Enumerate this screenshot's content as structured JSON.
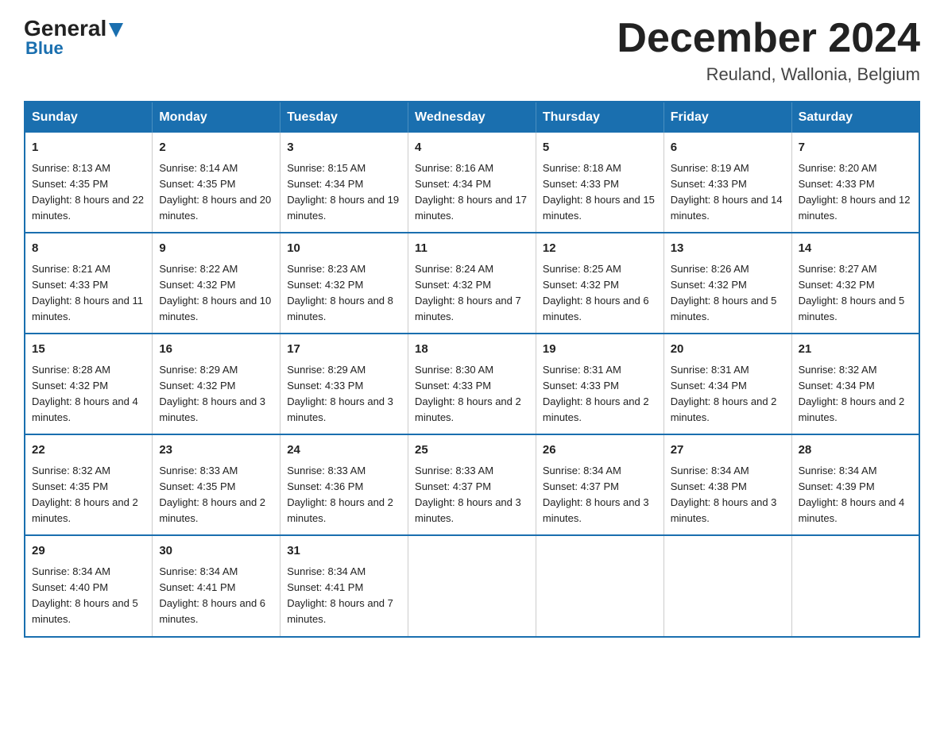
{
  "header": {
    "logo_text_general": "General",
    "logo_text_blue": "Blue",
    "month_title": "December 2024",
    "location": "Reuland, Wallonia, Belgium"
  },
  "calendar": {
    "days_of_week": [
      "Sunday",
      "Monday",
      "Tuesday",
      "Wednesday",
      "Thursday",
      "Friday",
      "Saturday"
    ],
    "weeks": [
      [
        {
          "day": "1",
          "sunrise": "Sunrise: 8:13 AM",
          "sunset": "Sunset: 4:35 PM",
          "daylight": "Daylight: 8 hours and 22 minutes."
        },
        {
          "day": "2",
          "sunrise": "Sunrise: 8:14 AM",
          "sunset": "Sunset: 4:35 PM",
          "daylight": "Daylight: 8 hours and 20 minutes."
        },
        {
          "day": "3",
          "sunrise": "Sunrise: 8:15 AM",
          "sunset": "Sunset: 4:34 PM",
          "daylight": "Daylight: 8 hours and 19 minutes."
        },
        {
          "day": "4",
          "sunrise": "Sunrise: 8:16 AM",
          "sunset": "Sunset: 4:34 PM",
          "daylight": "Daylight: 8 hours and 17 minutes."
        },
        {
          "day": "5",
          "sunrise": "Sunrise: 8:18 AM",
          "sunset": "Sunset: 4:33 PM",
          "daylight": "Daylight: 8 hours and 15 minutes."
        },
        {
          "day": "6",
          "sunrise": "Sunrise: 8:19 AM",
          "sunset": "Sunset: 4:33 PM",
          "daylight": "Daylight: 8 hours and 14 minutes."
        },
        {
          "day": "7",
          "sunrise": "Sunrise: 8:20 AM",
          "sunset": "Sunset: 4:33 PM",
          "daylight": "Daylight: 8 hours and 12 minutes."
        }
      ],
      [
        {
          "day": "8",
          "sunrise": "Sunrise: 8:21 AM",
          "sunset": "Sunset: 4:33 PM",
          "daylight": "Daylight: 8 hours and 11 minutes."
        },
        {
          "day": "9",
          "sunrise": "Sunrise: 8:22 AM",
          "sunset": "Sunset: 4:32 PM",
          "daylight": "Daylight: 8 hours and 10 minutes."
        },
        {
          "day": "10",
          "sunrise": "Sunrise: 8:23 AM",
          "sunset": "Sunset: 4:32 PM",
          "daylight": "Daylight: 8 hours and 8 minutes."
        },
        {
          "day": "11",
          "sunrise": "Sunrise: 8:24 AM",
          "sunset": "Sunset: 4:32 PM",
          "daylight": "Daylight: 8 hours and 7 minutes."
        },
        {
          "day": "12",
          "sunrise": "Sunrise: 8:25 AM",
          "sunset": "Sunset: 4:32 PM",
          "daylight": "Daylight: 8 hours and 6 minutes."
        },
        {
          "day": "13",
          "sunrise": "Sunrise: 8:26 AM",
          "sunset": "Sunset: 4:32 PM",
          "daylight": "Daylight: 8 hours and 5 minutes."
        },
        {
          "day": "14",
          "sunrise": "Sunrise: 8:27 AM",
          "sunset": "Sunset: 4:32 PM",
          "daylight": "Daylight: 8 hours and 5 minutes."
        }
      ],
      [
        {
          "day": "15",
          "sunrise": "Sunrise: 8:28 AM",
          "sunset": "Sunset: 4:32 PM",
          "daylight": "Daylight: 8 hours and 4 minutes."
        },
        {
          "day": "16",
          "sunrise": "Sunrise: 8:29 AM",
          "sunset": "Sunset: 4:32 PM",
          "daylight": "Daylight: 8 hours and 3 minutes."
        },
        {
          "day": "17",
          "sunrise": "Sunrise: 8:29 AM",
          "sunset": "Sunset: 4:33 PM",
          "daylight": "Daylight: 8 hours and 3 minutes."
        },
        {
          "day": "18",
          "sunrise": "Sunrise: 8:30 AM",
          "sunset": "Sunset: 4:33 PM",
          "daylight": "Daylight: 8 hours and 2 minutes."
        },
        {
          "day": "19",
          "sunrise": "Sunrise: 8:31 AM",
          "sunset": "Sunset: 4:33 PM",
          "daylight": "Daylight: 8 hours and 2 minutes."
        },
        {
          "day": "20",
          "sunrise": "Sunrise: 8:31 AM",
          "sunset": "Sunset: 4:34 PM",
          "daylight": "Daylight: 8 hours and 2 minutes."
        },
        {
          "day": "21",
          "sunrise": "Sunrise: 8:32 AM",
          "sunset": "Sunset: 4:34 PM",
          "daylight": "Daylight: 8 hours and 2 minutes."
        }
      ],
      [
        {
          "day": "22",
          "sunrise": "Sunrise: 8:32 AM",
          "sunset": "Sunset: 4:35 PM",
          "daylight": "Daylight: 8 hours and 2 minutes."
        },
        {
          "day": "23",
          "sunrise": "Sunrise: 8:33 AM",
          "sunset": "Sunset: 4:35 PM",
          "daylight": "Daylight: 8 hours and 2 minutes."
        },
        {
          "day": "24",
          "sunrise": "Sunrise: 8:33 AM",
          "sunset": "Sunset: 4:36 PM",
          "daylight": "Daylight: 8 hours and 2 minutes."
        },
        {
          "day": "25",
          "sunrise": "Sunrise: 8:33 AM",
          "sunset": "Sunset: 4:37 PM",
          "daylight": "Daylight: 8 hours and 3 minutes."
        },
        {
          "day": "26",
          "sunrise": "Sunrise: 8:34 AM",
          "sunset": "Sunset: 4:37 PM",
          "daylight": "Daylight: 8 hours and 3 minutes."
        },
        {
          "day": "27",
          "sunrise": "Sunrise: 8:34 AM",
          "sunset": "Sunset: 4:38 PM",
          "daylight": "Daylight: 8 hours and 3 minutes."
        },
        {
          "day": "28",
          "sunrise": "Sunrise: 8:34 AM",
          "sunset": "Sunset: 4:39 PM",
          "daylight": "Daylight: 8 hours and 4 minutes."
        }
      ],
      [
        {
          "day": "29",
          "sunrise": "Sunrise: 8:34 AM",
          "sunset": "Sunset: 4:40 PM",
          "daylight": "Daylight: 8 hours and 5 minutes."
        },
        {
          "day": "30",
          "sunrise": "Sunrise: 8:34 AM",
          "sunset": "Sunset: 4:41 PM",
          "daylight": "Daylight: 8 hours and 6 minutes."
        },
        {
          "day": "31",
          "sunrise": "Sunrise: 8:34 AM",
          "sunset": "Sunset: 4:41 PM",
          "daylight": "Daylight: 8 hours and 7 minutes."
        },
        null,
        null,
        null,
        null
      ]
    ]
  }
}
